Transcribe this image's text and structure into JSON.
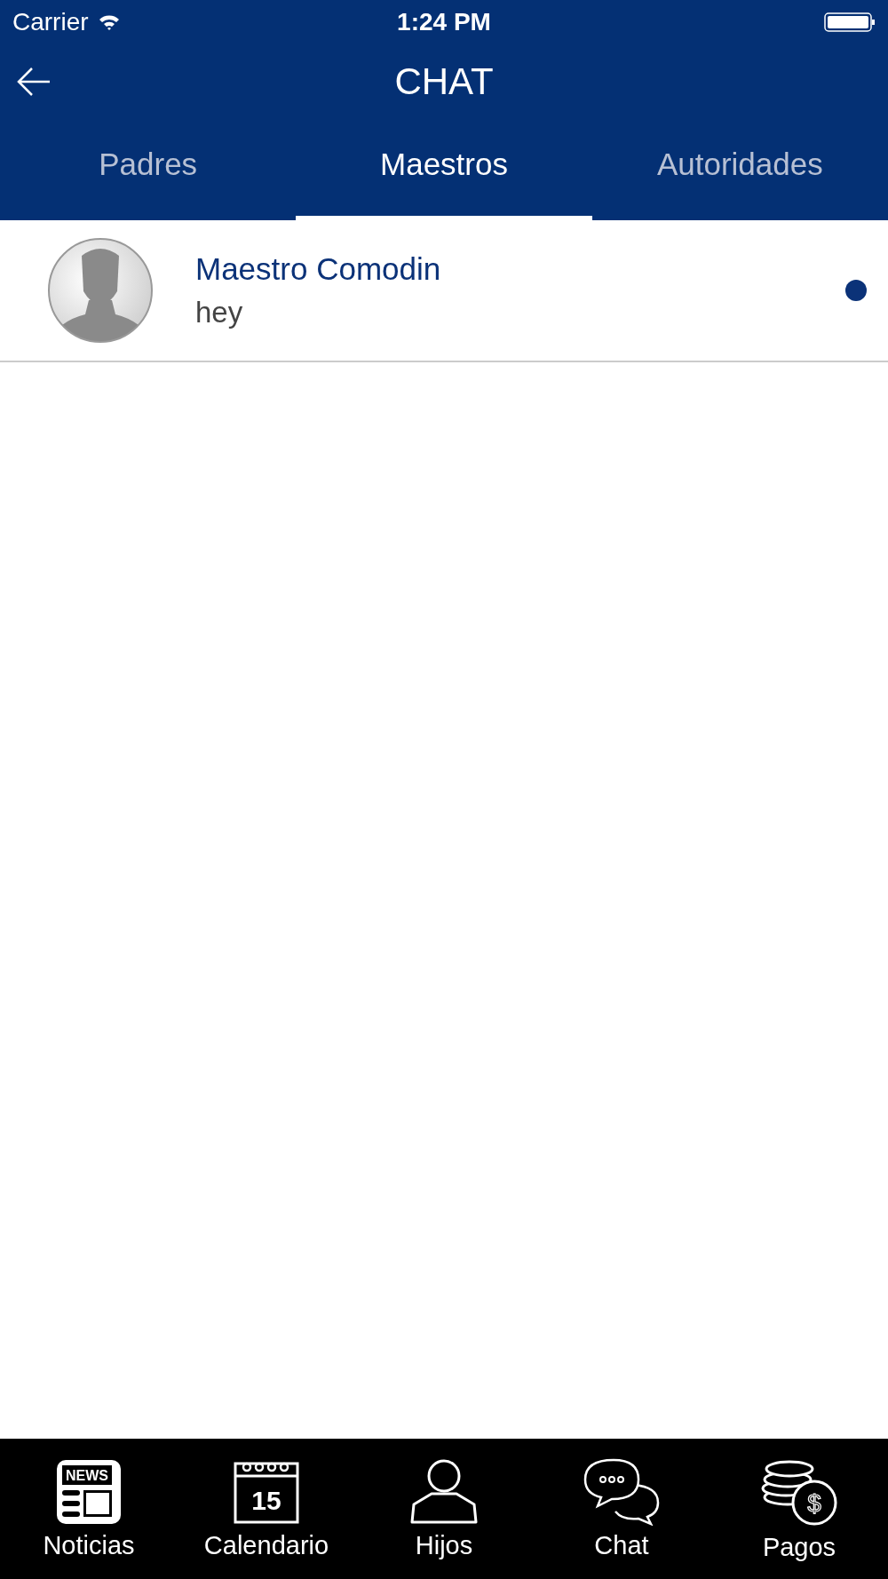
{
  "status_bar": {
    "carrier": "Carrier",
    "time": "1:24 PM"
  },
  "nav": {
    "title": "CHAT"
  },
  "tabs": [
    {
      "label": "Padres",
      "selected": false
    },
    {
      "label": "Maestros",
      "selected": true
    },
    {
      "label": "Autoridades",
      "selected": false
    }
  ],
  "chats": [
    {
      "name": "Maestro Comodin",
      "message": "hey",
      "unread": true
    }
  ],
  "tab_bar": [
    {
      "kind": "news",
      "label": "Noticias",
      "icon_text": "NEWS"
    },
    {
      "kind": "calendar",
      "label": "Calendario",
      "icon_text": "15"
    },
    {
      "kind": "person",
      "label": "Hijos"
    },
    {
      "kind": "chat",
      "label": "Chat"
    },
    {
      "kind": "coins",
      "label": "Pagos",
      "icon_text": "$"
    }
  ]
}
